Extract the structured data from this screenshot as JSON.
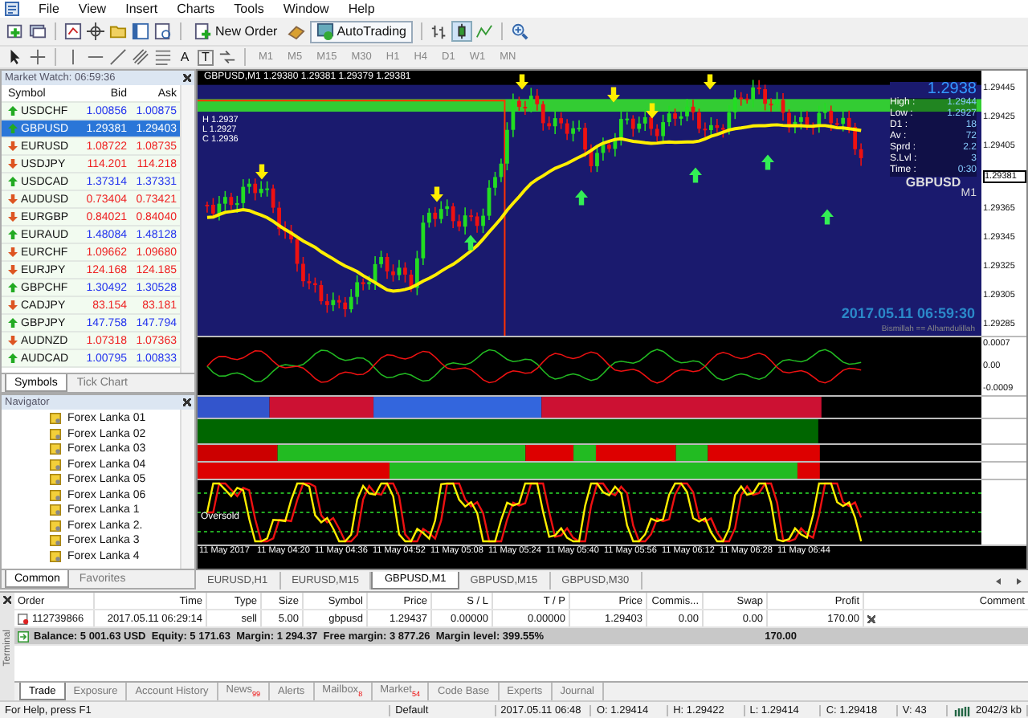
{
  "menu": [
    "File",
    "View",
    "Insert",
    "Charts",
    "Tools",
    "Window",
    "Help"
  ],
  "toolbar": {
    "new_order": "New Order",
    "autotrading": "AutoTrading",
    "text_tool": "A",
    "text_label_tool": "T",
    "timeframes": [
      "M1",
      "M5",
      "M15",
      "M30",
      "H1",
      "H4",
      "D1",
      "W1",
      "MN"
    ]
  },
  "market_watch": {
    "title": "Market Watch: 06:59:36",
    "columns": [
      "Symbol",
      "Bid",
      "Ask"
    ],
    "rows": [
      {
        "symbol": "USDCHF",
        "bid": "1.00856",
        "ask": "1.00875",
        "rising": true,
        "selected": false
      },
      {
        "symbol": "GBPUSD",
        "bid": "1.29381",
        "ask": "1.29403",
        "rising": true,
        "selected": true
      },
      {
        "symbol": "EURUSD",
        "bid": "1.08722",
        "ask": "1.08735",
        "rising": false,
        "selected": false
      },
      {
        "symbol": "USDJPY",
        "bid": "114.201",
        "ask": "114.218",
        "rising": false,
        "selected": false
      },
      {
        "symbol": "USDCAD",
        "bid": "1.37314",
        "ask": "1.37331",
        "rising": true,
        "selected": false
      },
      {
        "symbol": "AUDUSD",
        "bid": "0.73404",
        "ask": "0.73421",
        "rising": false,
        "selected": false
      },
      {
        "symbol": "EURGBP",
        "bid": "0.84021",
        "ask": "0.84040",
        "rising": false,
        "selected": false
      },
      {
        "symbol": "EURAUD",
        "bid": "1.48084",
        "ask": "1.48128",
        "rising": true,
        "selected": false
      },
      {
        "symbol": "EURCHF",
        "bid": "1.09662",
        "ask": "1.09680",
        "rising": false,
        "selected": false
      },
      {
        "symbol": "EURJPY",
        "bid": "124.168",
        "ask": "124.185",
        "rising": false,
        "selected": false
      },
      {
        "symbol": "GBPCHF",
        "bid": "1.30492",
        "ask": "1.30528",
        "rising": true,
        "selected": false
      },
      {
        "symbol": "CADJPY",
        "bid": "83.154",
        "ask": "83.181",
        "rising": false,
        "selected": false
      },
      {
        "symbol": "GBPJPY",
        "bid": "147.758",
        "ask": "147.794",
        "rising": true,
        "selected": false
      },
      {
        "symbol": "AUDNZD",
        "bid": "1.07318",
        "ask": "1.07363",
        "rising": false,
        "selected": false
      },
      {
        "symbol": "AUDCAD",
        "bid": "1.00795",
        "ask": "1.00833",
        "rising": true,
        "selected": false
      }
    ],
    "tabs": [
      {
        "label": "Symbols",
        "selected": true
      },
      {
        "label": "Tick Chart",
        "selected": false
      }
    ]
  },
  "navigator": {
    "title": "Navigator",
    "items": [
      "Forex Lanka 01",
      "Forex Lanka 02",
      "Forex Lanka 03",
      "Forex Lanka 04",
      "Forex Lanka 05",
      "Forex Lanka 06",
      "Forex Lanka 1",
      "Forex Lanka 2.",
      "Forex Lanka 3",
      "Forex Lanka 4"
    ],
    "tabs": [
      {
        "label": "Common",
        "selected": true
      },
      {
        "label": "Favorites",
        "selected": false
      }
    ]
  },
  "chart": {
    "header": "GBPUSD,M1  1.29380 1.29381 1.29379 1.29381",
    "ohlc": [
      "H 1.2937",
      "L 1.2927",
      "C 1.2936"
    ],
    "info": {
      "price": "1.2938",
      "rows": [
        {
          "label": "High :",
          "value": "1.2944"
        },
        {
          "label": "Low :",
          "value": "1.2927"
        },
        {
          "label": "D1 :",
          "value": "18"
        },
        {
          "label": "Av :",
          "value": "72"
        },
        {
          "label": "Sprd :",
          "value": "2.2"
        },
        {
          "label": "S.Lvl :",
          "value": "3"
        },
        {
          "label": "Time :",
          "value": "0:30"
        }
      ],
      "symbol": "GBPUSD",
      "timeframe": "M1",
      "datetime": "2017.05.11 06:59:30",
      "footer": "Bismillah == Alhamdulillah"
    },
    "price_axis": [
      {
        "label": "1.29445",
        "current": false
      },
      {
        "label": "1.29425",
        "current": false
      },
      {
        "label": "1.29405",
        "current": false
      },
      {
        "label": "1.29381",
        "current": true
      },
      {
        "label": "1.29365",
        "current": false
      },
      {
        "label": "1.29345",
        "current": false
      },
      {
        "label": "1.29325",
        "current": false
      },
      {
        "label": "1.29305",
        "current": false
      },
      {
        "label": "1.29285",
        "current": false
      }
    ],
    "oscillator_axis": [
      "0.0007",
      "0.00",
      "-0.0009"
    ],
    "stoch_label": "Oversold",
    "time_axis": [
      "11 May 2017",
      "11 May 04:20",
      "11 May 04:36",
      "11 May 04:52",
      "11 May 05:08",
      "11 May 05:24",
      "11 May 05:40",
      "11 May 05:56",
      "11 May 06:12",
      "11 May 06:28",
      "11 May 06:44"
    ],
    "tabs": [
      {
        "label": "EURUSD,H1",
        "selected": false
      },
      {
        "label": "EURUSD,M15",
        "selected": false
      },
      {
        "label": "GBPUSD,M1",
        "selected": true
      },
      {
        "label": "GBPUSD,M15",
        "selected": false
      },
      {
        "label": "GBPUSD,M30",
        "selected": false
      }
    ]
  },
  "terminal": {
    "title": "Terminal",
    "columns": [
      "Order",
      "Time",
      "Type",
      "Size",
      "Symbol",
      "Price",
      "S / L",
      "T / P",
      "Price",
      "Commis...",
      "Swap",
      "Profit",
      "Comment"
    ],
    "rows": [
      {
        "cells": [
          "112739866",
          "2017.05.11 06:29:14",
          "sell",
          "5.00",
          "gbpusd",
          "1.29437",
          "0.00000",
          "0.00000",
          "1.29403",
          "0.00",
          "0.00",
          "170.00"
        ]
      }
    ],
    "summary": "Balance: 5 001.63 USD  Equity: 5 171.63  Margin: 1 294.37  Free margin: 3 877.26  Margin level: 399.55%",
    "summary_profit": "170.00",
    "tabs": [
      {
        "label": "Trade",
        "selected": true
      },
      {
        "label": "Exposure",
        "selected": false
      },
      {
        "label": "Account History",
        "selected": false
      },
      {
        "label": "News",
        "badge": "99",
        "selected": false
      },
      {
        "label": "Alerts",
        "selected": false
      },
      {
        "label": "Mailbox",
        "badge": "8",
        "selected": false
      },
      {
        "label": "Market",
        "badge": "54",
        "selected": false
      },
      {
        "label": "Code Base",
        "selected": false
      },
      {
        "label": "Experts",
        "selected": false
      },
      {
        "label": "Journal",
        "selected": false
      }
    ]
  },
  "status_bar": [
    "For Help, press F1",
    "Default",
    "2017.05.11 06:48",
    "O: 1.29414",
    "H: 1.29422",
    "L: 1.29414",
    "C: 1.29418",
    "V: 43",
    "2042/3 kb"
  ]
}
